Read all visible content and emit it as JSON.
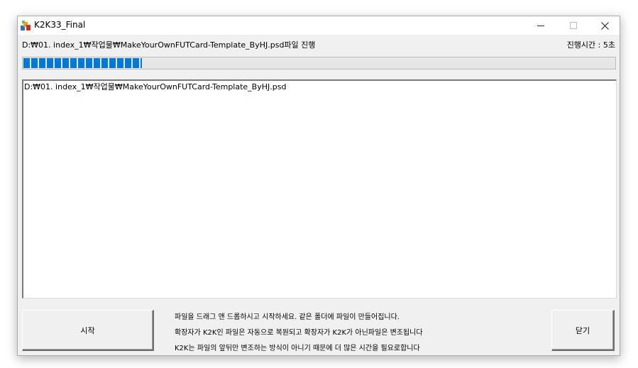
{
  "window": {
    "title": "K2K33_Final",
    "minimize_label": "minimize",
    "maximize_label": "maximize",
    "close_label": "close"
  },
  "status": {
    "current_path": "D:₩01. index_1₩작업물₩MakeYourOwnFUTCard-Template_ByHJ.psd파일 진행",
    "elapsed_label": "진행시간 : ",
    "elapsed_value": "5초"
  },
  "progress": {
    "percent": 20,
    "color": "#0078d7"
  },
  "log": {
    "lines": [
      "D:₩01. index_1₩작업물₩MakeYourOwnFUTCard-Template_ByHJ.psd"
    ]
  },
  "buttons": {
    "start_label": "시작",
    "done_label": "닫기"
  },
  "info": {
    "lines": [
      "파일을 드래그 앤 드롭하시고 시작하세요. 같은 폴더에 파일이 만들어집니다.",
      "확장자가 K2K인 파일은 자동으로 복원되고 확장자가 K2K가 아닌파일은 변조됩니다",
      "K2K는 파일의 앞뒤만 변조하는 방식이 아니기 때문에 더 많은 시간을 필요로합니다"
    ]
  },
  "icons": {
    "app": "app-icon",
    "minimize": "minimize-icon",
    "maximize": "maximize-icon",
    "close": "close-icon"
  }
}
